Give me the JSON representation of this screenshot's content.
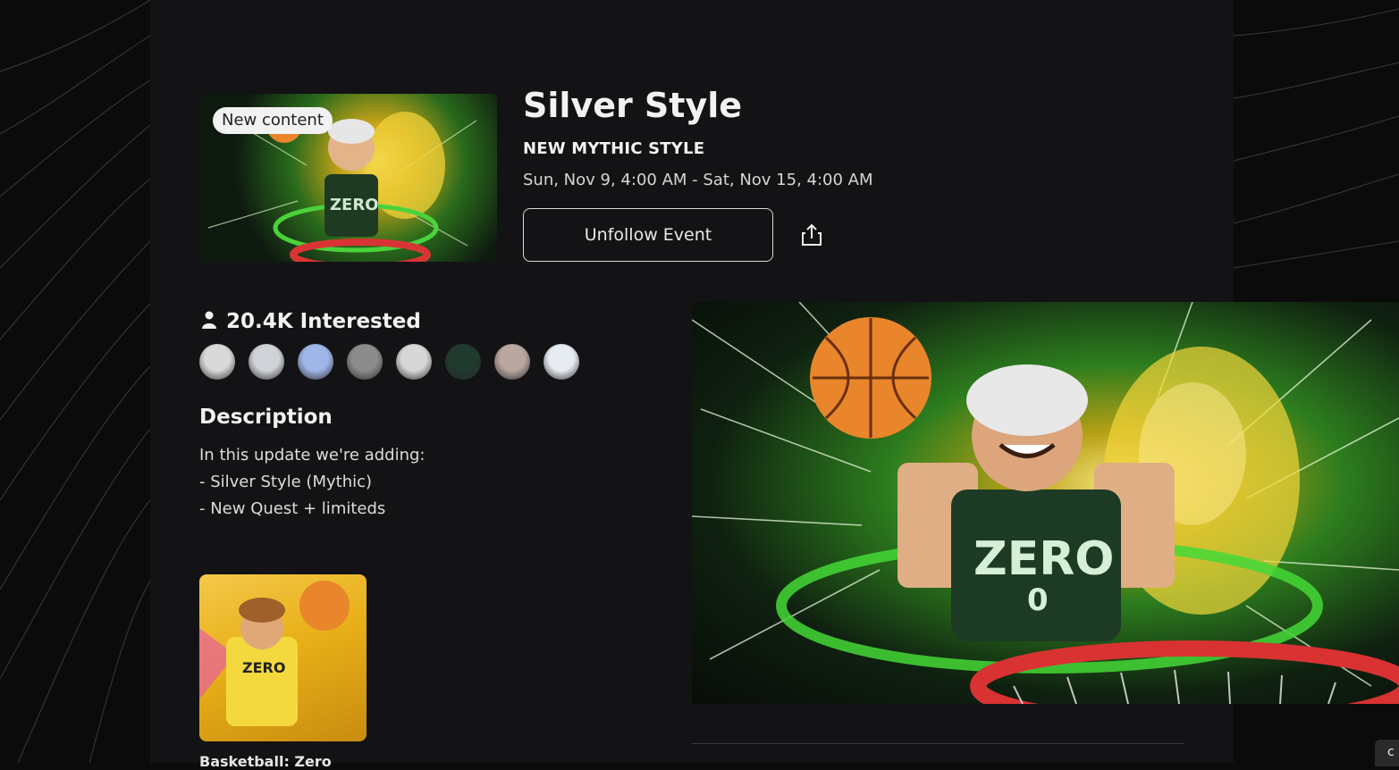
{
  "event": {
    "badge": "New content",
    "title": "Silver Style",
    "subtitle": "NEW MYTHIC STYLE",
    "dates": "Sun, Nov 9, 4:00 AM - Sat, Nov 15, 4:00 AM",
    "unfollow_label": "Unfollow Event"
  },
  "interested": {
    "count_label": "20.4K Interested",
    "avatars": [
      "#d9d9d9",
      "#cfd3d8",
      "#9fb6e8",
      "#8c8c8c",
      "#d7d7d7",
      "#1f3a2e",
      "#b9a7a0",
      "#e6ecf2"
    ]
  },
  "description": {
    "heading": "Description",
    "lines": [
      "In this update we're adding:",
      "- Silver Style (Mythic)",
      "- New Quest + limiteds"
    ]
  },
  "game": {
    "name": "Basketball: Zero"
  },
  "corner_tab_label": "c",
  "icons": {
    "share": "share-icon",
    "person": "person-icon"
  },
  "colors": {
    "panel": "#131315",
    "background": "#0b0b0c",
    "accent_green": "#3fd13a"
  }
}
